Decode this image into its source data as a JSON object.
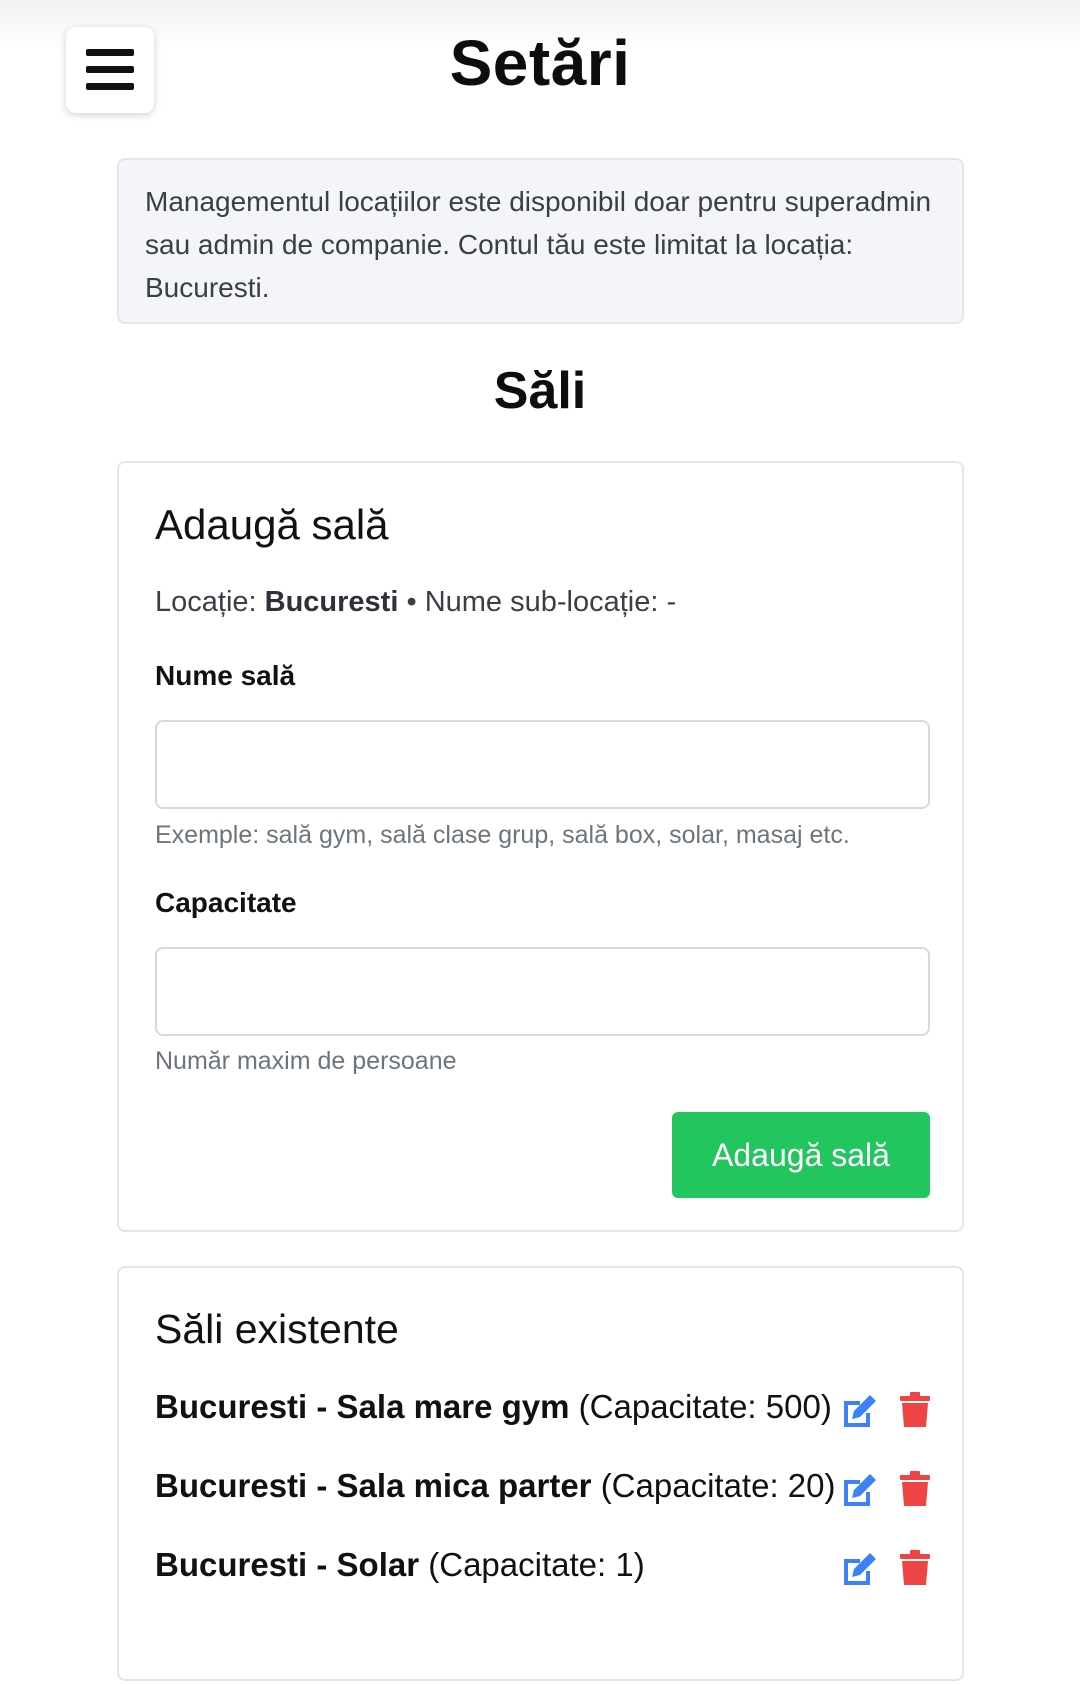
{
  "header": {
    "title": "Setări",
    "menu_icon": "hamburger-menu-icon"
  },
  "notice": {
    "text": "Managementul locațiilor este disponibil doar pentru superadmin sau admin de companie. Contul tău este limitat la locația: Bucuresti."
  },
  "section": {
    "title": "Săli"
  },
  "add_room": {
    "title": "Adaugă sală",
    "location_label": "Locație:",
    "location_value": "Bucuresti",
    "separator": "•",
    "sublocation_label": "Nume sub-locație:",
    "sublocation_value": "-",
    "name_label": "Nume sală",
    "name_value": "",
    "name_hint": "Exemple: sală gym, sală clase grup, sală box, solar, masaj etc.",
    "capacity_label": "Capacitate",
    "capacity_value": "",
    "capacity_hint": "Număr maxim de persoane",
    "submit_label": "Adaugă sală",
    "submit_color": "#22c55e"
  },
  "existing": {
    "title": "Săli existente",
    "edit_icon": "edit-icon",
    "delete_icon": "trash-icon",
    "edit_color": "#3b82f6",
    "delete_color": "#ef4444",
    "rooms": [
      {
        "name": "Bucuresti - Sala mare gym",
        "capacity": "(Capacitate: 500)"
      },
      {
        "name": "Bucuresti - Sala mica parter",
        "capacity": "(Capacitate: 20)"
      },
      {
        "name": "Bucuresti - Solar",
        "capacity": "(Capacitate: 1)"
      }
    ]
  }
}
